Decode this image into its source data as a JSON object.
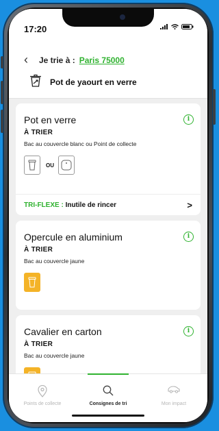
{
  "status_bar": {
    "time": "17:20",
    "icons": [
      "signal-icon",
      "wifi-icon",
      "battery-icon"
    ]
  },
  "header": {
    "back_icon": "chevron-left-icon",
    "trie_label": "Je trie à :",
    "city": "Paris 75000",
    "product_icon": "recycle-bin-icon",
    "product_name": "Pot de yaourt en verre"
  },
  "cards": [
    {
      "title": "Pot en verre",
      "status": "À TRIER",
      "description": "Bac au couvercle blanc ou Point de collecte",
      "or_label": "OU",
      "tri_prefix": "TRI-FLEXE :",
      "tri_text": "Inutile de rincer"
    },
    {
      "title": "Opercule en aluminium",
      "status": "À TRIER",
      "description": "Bac au couvercle jaune"
    },
    {
      "title": "Cavalier en carton",
      "status": "À TRIER",
      "description": "Bac au couvercle jaune"
    }
  ],
  "tabs": [
    {
      "label": "Points de collecte",
      "icon": "map-pin-icon"
    },
    {
      "label": "Consignes de tri",
      "icon": "search-icon"
    },
    {
      "label": "Mon impact",
      "icon": "car-icon"
    }
  ],
  "colors": {
    "brand_green": "#2fb22f",
    "bin_yellow": "#f4b327",
    "background": "#1a8fe0"
  }
}
